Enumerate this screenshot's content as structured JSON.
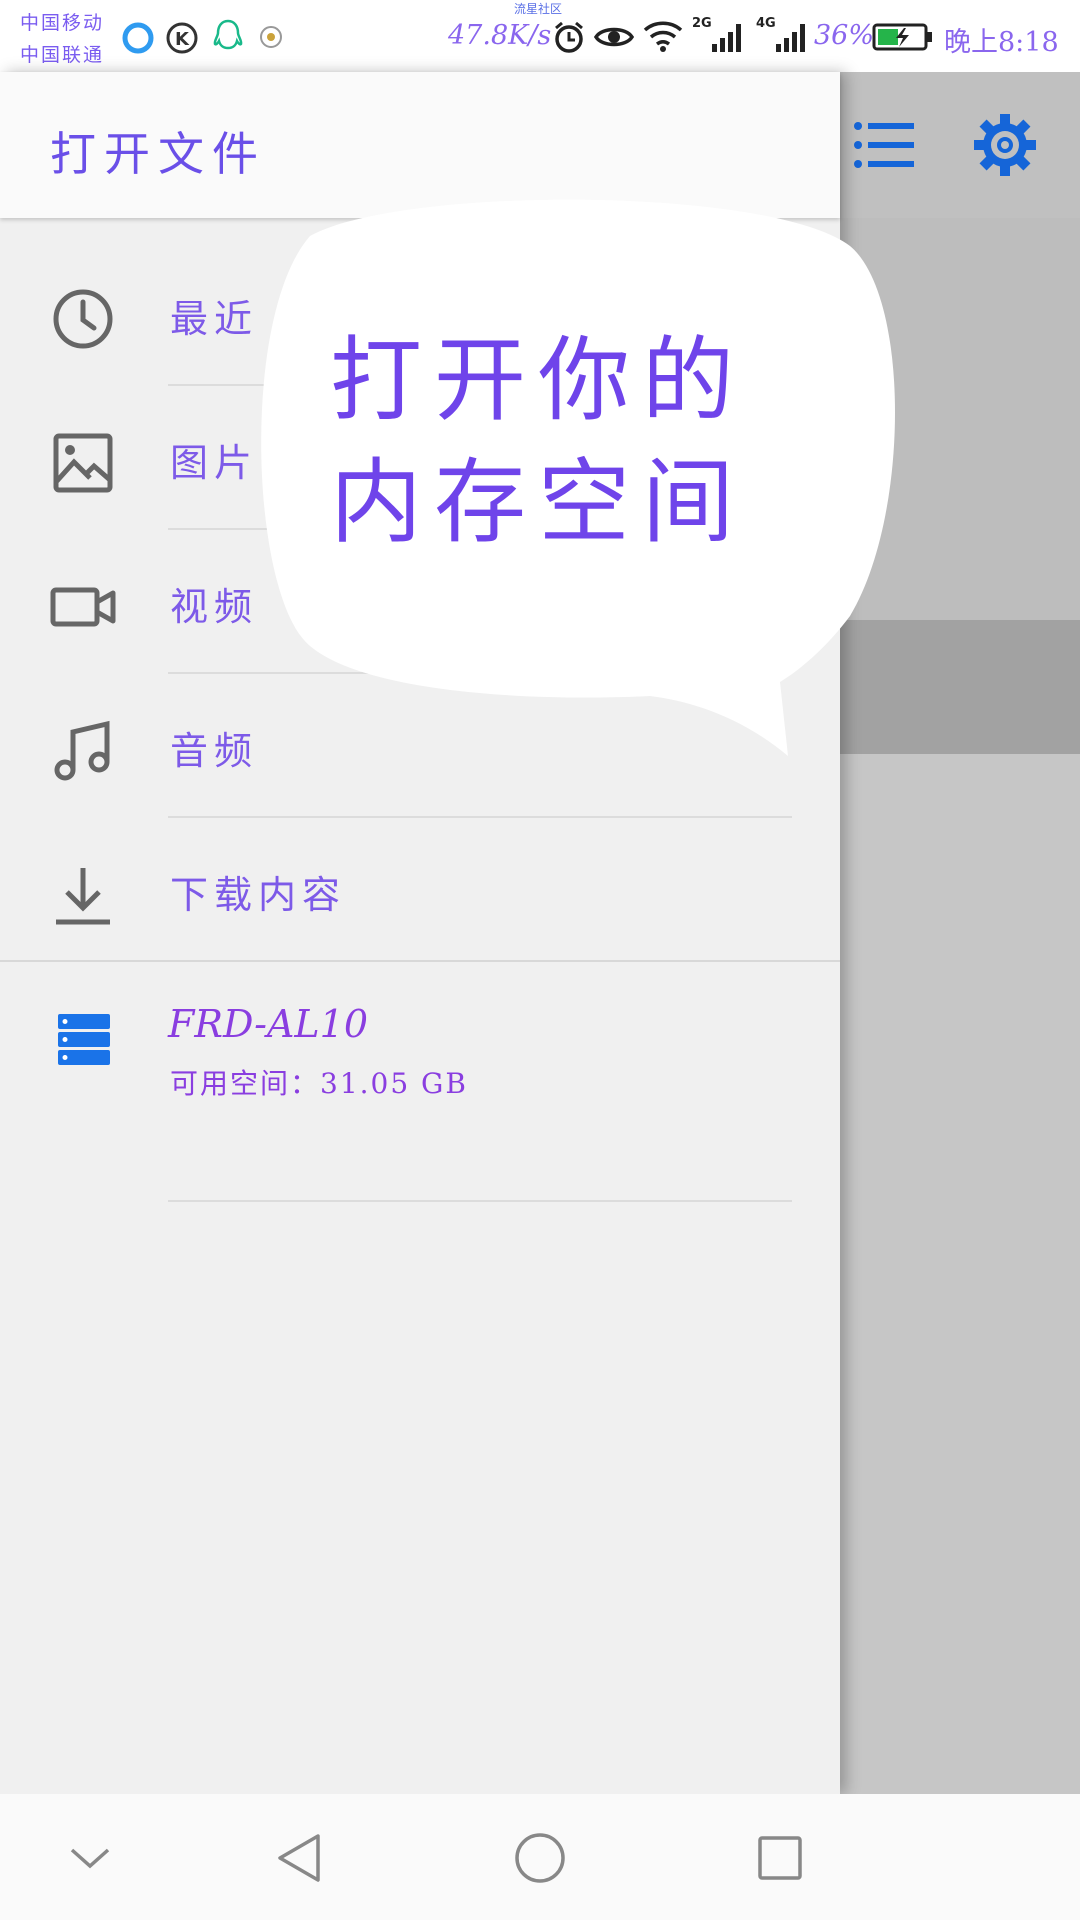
{
  "status_bar": {
    "carrier_1": "中国移动",
    "carrier_2": "中国联通",
    "community_label": "流星社区",
    "network_speed": "47.8K/s",
    "signal_1": "2G",
    "signal_2": "4G",
    "battery": "36%",
    "time": "晚上8:18"
  },
  "drawer": {
    "title": "打开文件",
    "items": [
      {
        "label": "最近",
        "icon": "clock-icon"
      },
      {
        "label": "图片",
        "icon": "image-icon"
      },
      {
        "label": "视频",
        "icon": "video-icon"
      },
      {
        "label": "音频",
        "icon": "music-icon"
      },
      {
        "label": "下载内容",
        "icon": "download-icon"
      }
    ],
    "storage": {
      "name": "FRD-AL10",
      "free_space": "可用空间：31.05 GB",
      "icon": "storage-icon"
    }
  },
  "toolbar": {
    "list_icon": "list-icon",
    "settings_icon": "gear-icon"
  },
  "bubble": {
    "line_1": "打开你的",
    "line_2": "内存空间"
  },
  "navbar": {
    "buttons": [
      "collapse-icon",
      "back-icon",
      "home-icon",
      "recents-icon"
    ]
  },
  "colors": {
    "accent_blue": "#1565d8",
    "storage_blue": "#1a73e8",
    "text_purple": "#7d5ae8"
  }
}
